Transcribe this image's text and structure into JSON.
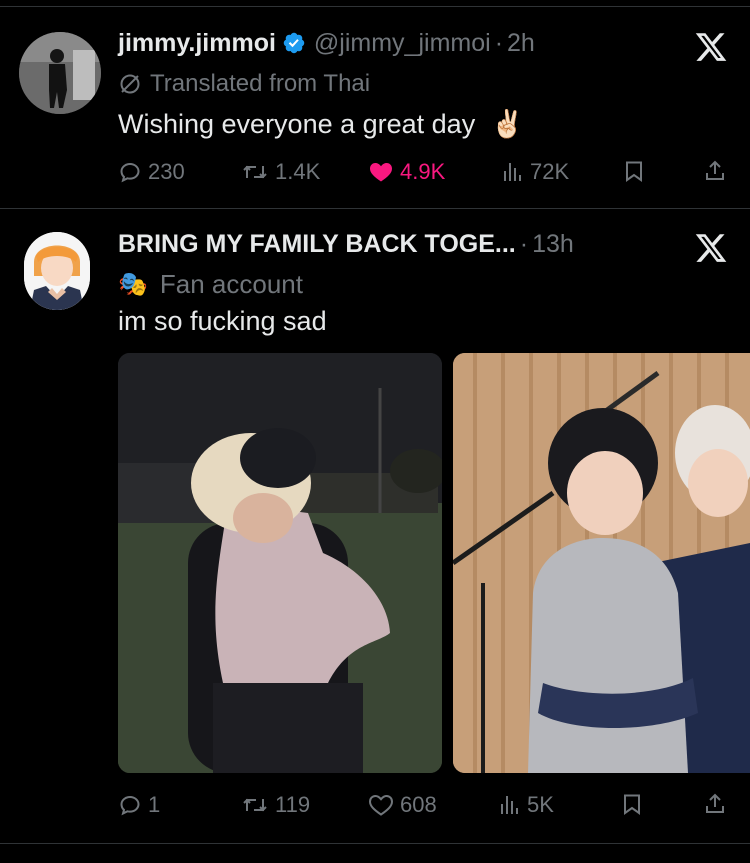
{
  "tweets": [
    {
      "author_name": "jimmy.jimmoi",
      "handle": "@jimmy_jimmoi",
      "separator": "·",
      "time": "2h",
      "verified": true,
      "translated_label": "Translated from Thai",
      "text": "Wishing everyone a great day",
      "emoji": "✌🏻",
      "actions": {
        "replies": "230",
        "reposts": "1.4K",
        "likes": "4.9K",
        "views": "72K"
      },
      "liked": true
    },
    {
      "author_name": "BRING MY FAMILY BACK TOGE...",
      "separator": "·",
      "time": "13h",
      "fan_label": "Fan account",
      "fan_emoji": "🎭",
      "text": "im so fucking sad",
      "actions": {
        "replies": "1",
        "reposts": "119",
        "likes": "608",
        "views": "5K"
      },
      "liked": false
    }
  ],
  "colors": {
    "background": "#000000",
    "text_primary": "#e7e9ea",
    "text_secondary": "#71767b",
    "like_active": "#f91880",
    "verified": "#1d9bf0",
    "divider": "#2f3336"
  },
  "icons": [
    "x-logo-icon",
    "verified-badge-icon",
    "translate-icon",
    "reply-icon",
    "repost-icon",
    "like-icon",
    "views-icon",
    "bookmark-icon",
    "share-icon"
  ]
}
